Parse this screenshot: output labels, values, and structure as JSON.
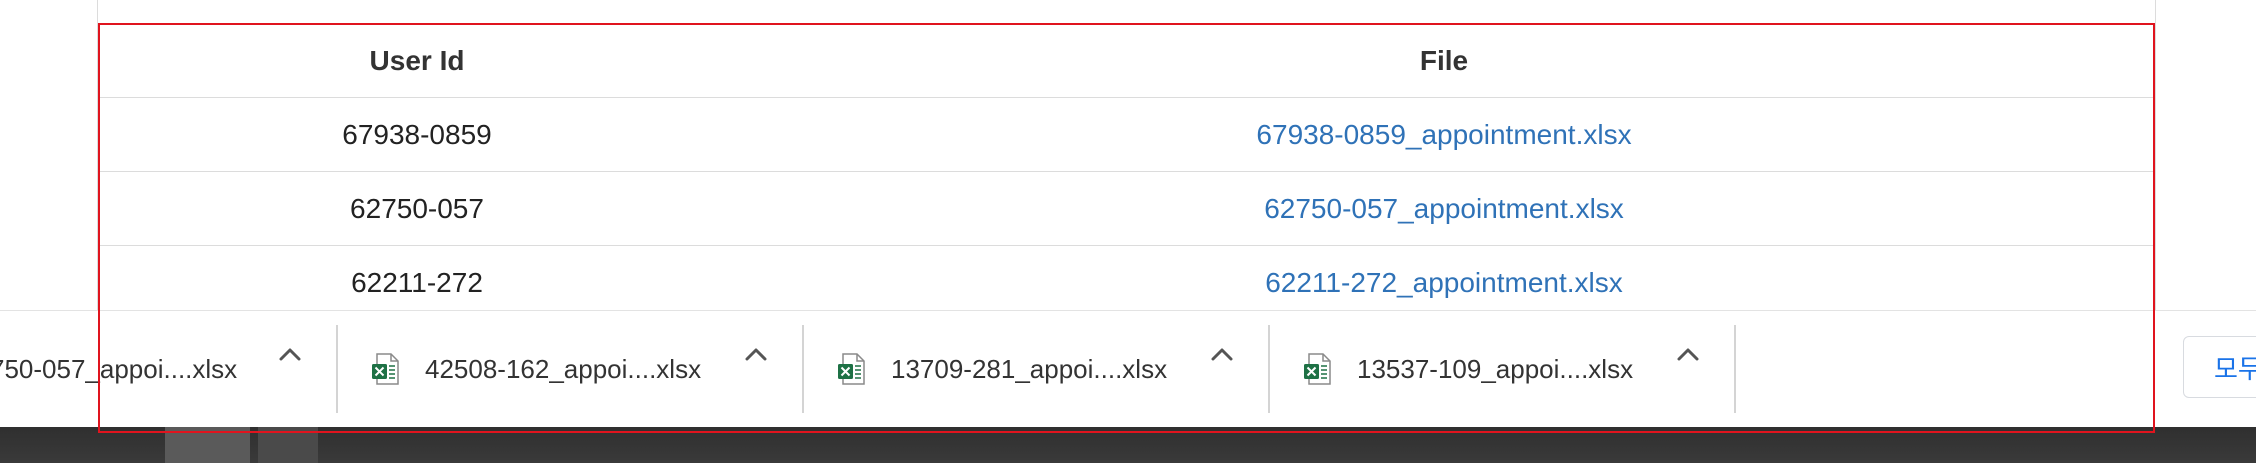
{
  "table": {
    "headers": {
      "user_id": "User Id",
      "file": "File"
    },
    "rows": [
      {
        "user_id": "67938-0859",
        "file": "67938-0859_appointment.xlsx"
      },
      {
        "user_id": "62750-057",
        "file": "62750-057_appointment.xlsx"
      },
      {
        "user_id": "62211-272",
        "file": "62211-272_appointment.xlsx"
      }
    ],
    "link_color": "#2f72b7"
  },
  "downloads_bar": {
    "items": [
      {
        "name": "750-057_appoi....xlsx",
        "icon": "excel-file-icon"
      },
      {
        "name": "42508-162_appoi....xlsx",
        "icon": "excel-file-icon"
      },
      {
        "name": "13709-281_appoi....xlsx",
        "icon": "excel-file-icon"
      },
      {
        "name": "13537-109_appoi....xlsx",
        "icon": "excel-file-icon"
      }
    ],
    "show_all_label": "모두"
  },
  "highlight_color": "#e0141e"
}
